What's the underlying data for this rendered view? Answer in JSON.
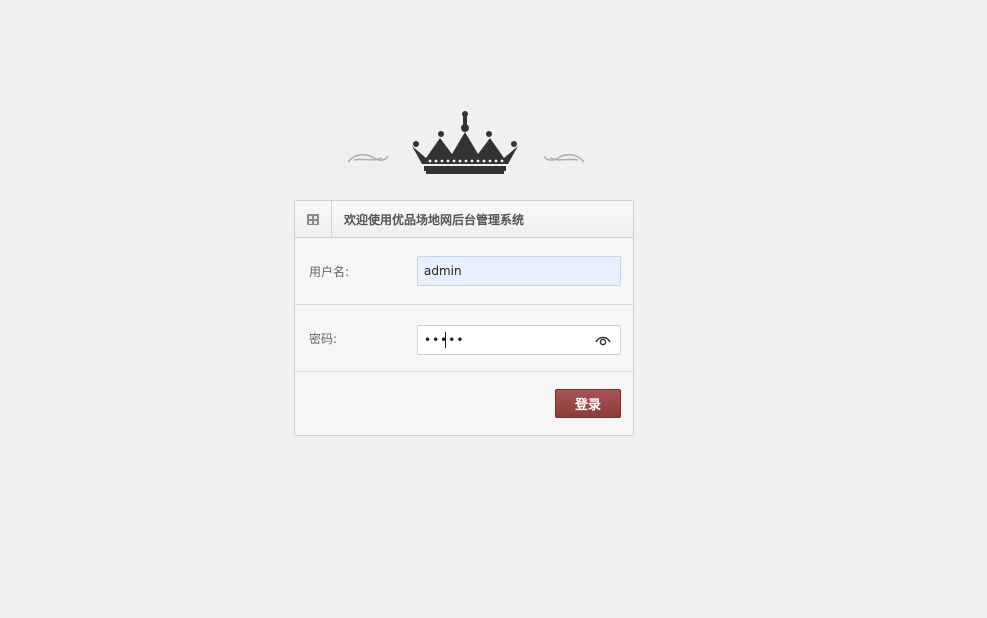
{
  "header": {
    "title": "欢迎使用优品场地网后台管理系统",
    "icon": "building-icon"
  },
  "form": {
    "username_label": "用户名:",
    "username_value": "admin",
    "password_label": "密码:",
    "password_value": "•••••",
    "password_toggle_icon": "eye-icon",
    "login_button": "登录"
  },
  "colors": {
    "background": "#f1f0ef",
    "login_button": "#9a4545",
    "autofill_input": "#e8f0fe"
  }
}
